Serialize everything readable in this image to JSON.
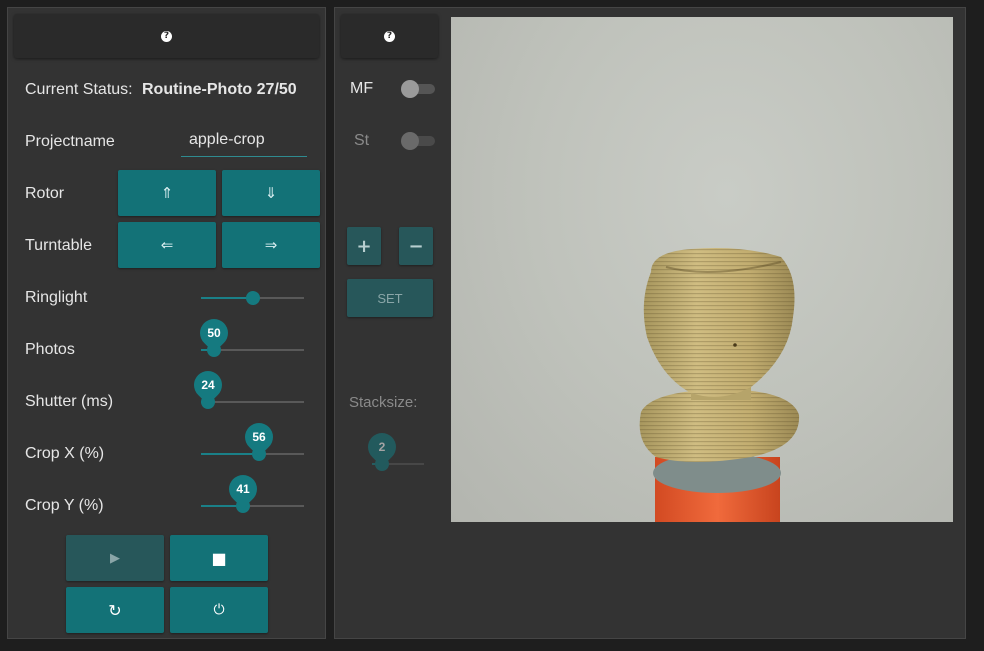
{
  "help_symbol": "?",
  "left": {
    "status_label": "Current Status:",
    "status_value": "Routine-Photo 27/50",
    "projectname_label": "Projectname",
    "projectname_value": "apple-crop",
    "rotor_label": "Rotor",
    "rotor_up": "⇑",
    "rotor_down": "⇓",
    "turntable_label": "Turntable",
    "turntable_left": "⇐",
    "turntable_right": "⇒",
    "ringlight_label": "Ringlight",
    "ringlight_level": 0.5,
    "photos_label": "Photos",
    "photos_value": "50",
    "photos_level": 0.13,
    "shutter_label": "Shutter (ms)",
    "shutter_value": "24",
    "shutter_level": 0.07,
    "cropx_label": "Crop X (%)",
    "cropx_value": "56",
    "cropx_level": 0.56,
    "cropy_label": "Crop Y (%)",
    "cropy_value": "41",
    "cropy_level": 0.41,
    "play_icon": "▶",
    "stop_icon": "■",
    "reload_icon": "↻",
    "power_icon": "⏻"
  },
  "mid": {
    "mf_label": "MF",
    "mf_on": false,
    "st_label": "St",
    "st_on": false,
    "plus": "+",
    "minus": "−",
    "set_label": "SET",
    "stacksize_label": "Stacksize:",
    "stacksize_value": "2",
    "stacksize_level": 0.2
  },
  "colors": {
    "accent": "#137277",
    "panel": "#333333",
    "background": "#1e1e1e"
  },
  "photo": {
    "subject": "carved wooden figure on orange post"
  }
}
